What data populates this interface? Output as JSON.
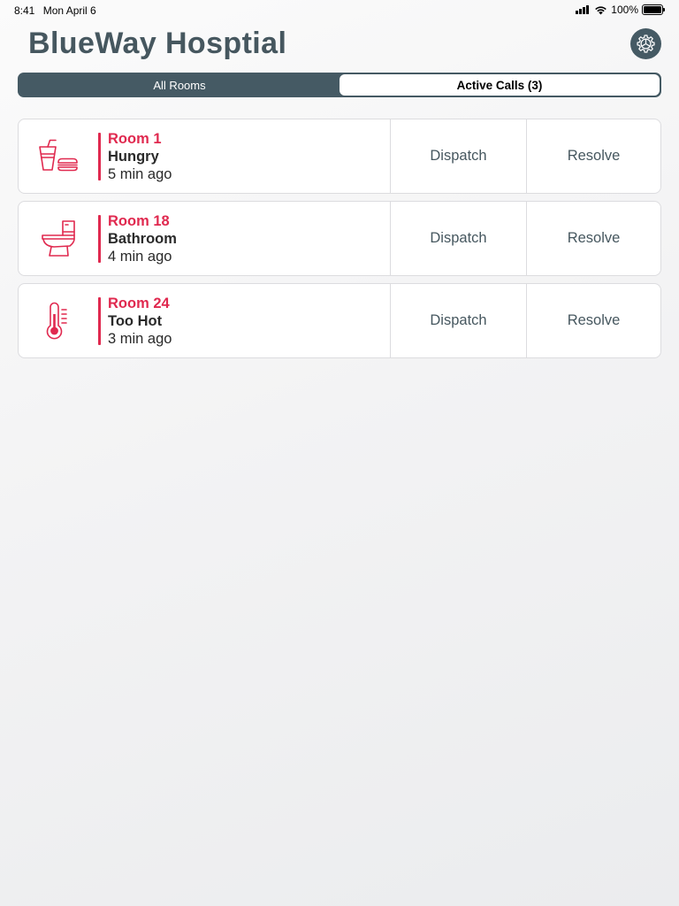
{
  "status_bar": {
    "time": "8:41",
    "date": "Mon April 6",
    "battery": "100%"
  },
  "header": {
    "title": "BlueWay Hosptial",
    "settings_icon": "gear-icon"
  },
  "tabs": {
    "all_rooms": "All Rooms",
    "active_calls": "Active Calls (3)",
    "selected": "active_calls"
  },
  "calls": [
    {
      "room": "Room 1",
      "type": "Hungry",
      "time": "5 min ago",
      "icon": "food-drink-icon",
      "dispatch": "Dispatch",
      "resolve": "Resolve"
    },
    {
      "room": "Room 18",
      "type": "Bathroom",
      "time": "4 min ago",
      "icon": "toilet-icon",
      "dispatch": "Dispatch",
      "resolve": "Resolve"
    },
    {
      "room": "Room 24",
      "type": "Too Hot",
      "time": "3 min ago",
      "icon": "thermometer-icon",
      "dispatch": "Dispatch",
      "resolve": "Resolve"
    }
  ],
  "colors": {
    "accent": "#e0294f",
    "primary": "#455a64",
    "title": "#46575f"
  }
}
